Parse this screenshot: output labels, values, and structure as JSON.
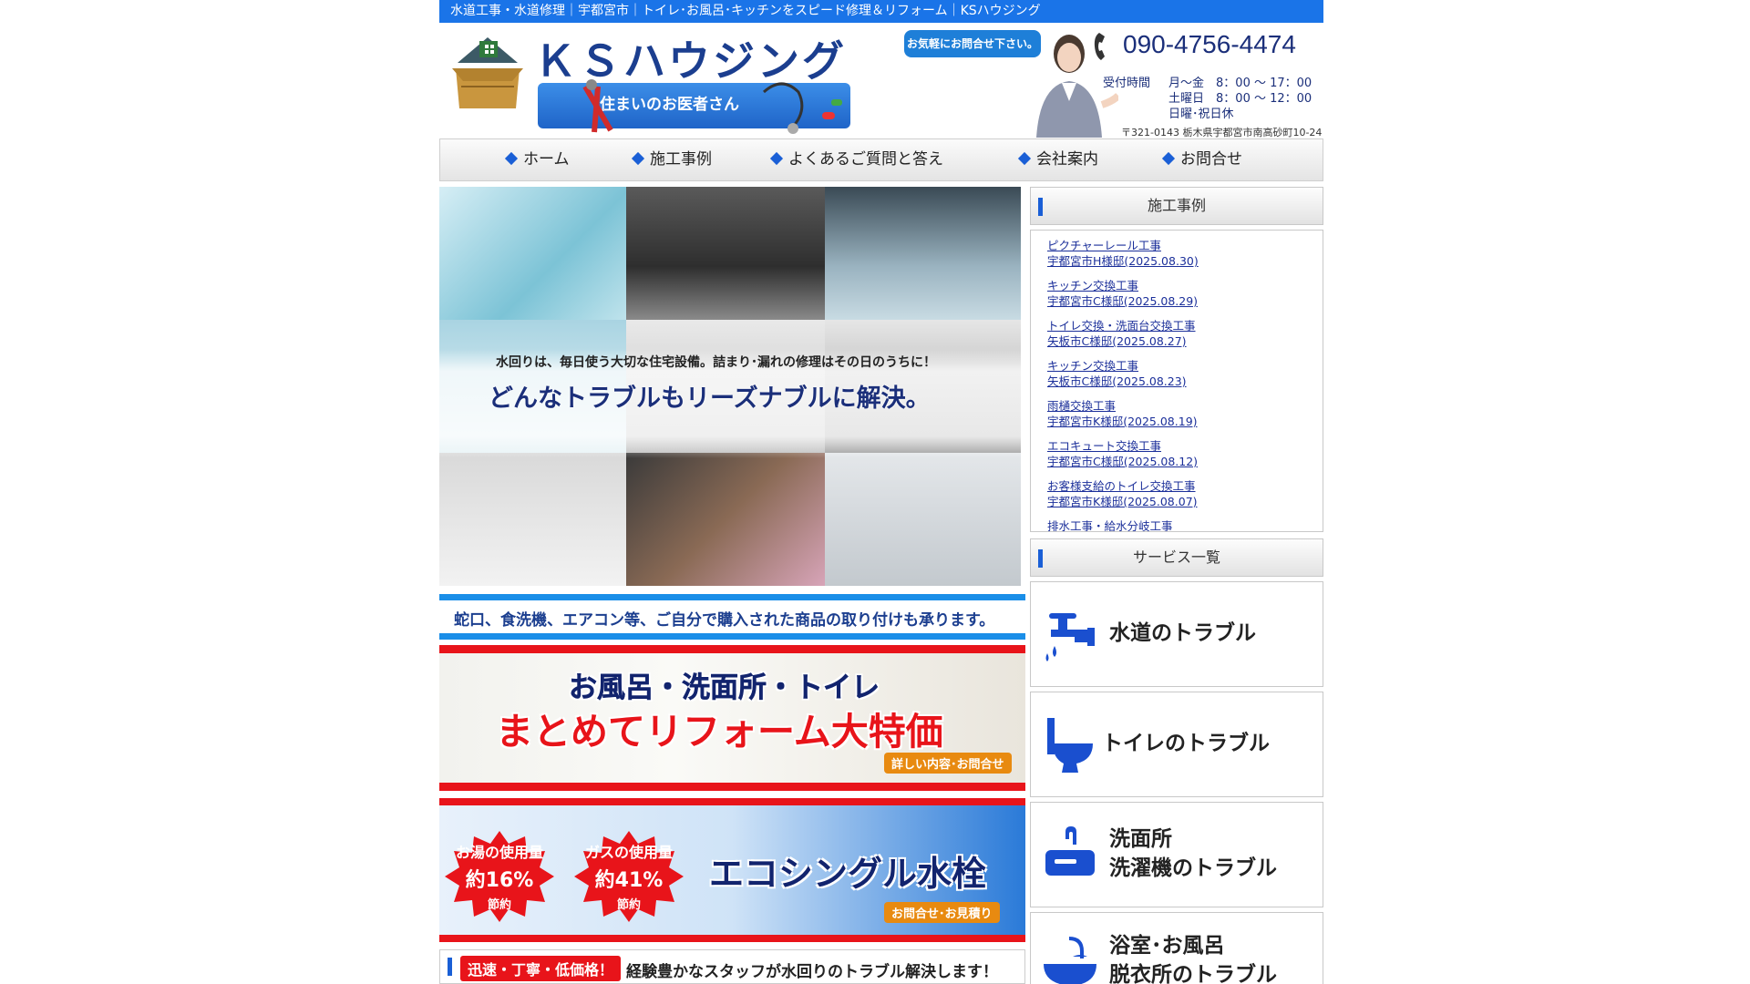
{
  "topbar": {
    "text": "水道工事・水道修理｜宇都宮市｜トイレ･お風呂･キッチンをスピード修理＆リフォーム｜KSハウジング"
  },
  "header": {
    "logo_text": "ＫＳハウジング",
    "logo_sub": "住まいのお医者さん",
    "bubble": "お気軽にお問合せ下さい。",
    "phone": "090-4756-4474",
    "hours": [
      {
        "label": "受付時間",
        "days": "月～金",
        "time": "8：00 ～ 17：00"
      },
      {
        "label": "",
        "days": "土曜日",
        "time": "8：00 ～ 12：00"
      },
      {
        "label": "",
        "days": "日曜･祝日休",
        "time": ""
      }
    ],
    "address": "〒321-0143 栃木県宇都宮市南高砂町10-24"
  },
  "nav": [
    {
      "label": "ホーム"
    },
    {
      "label": "施工事例"
    },
    {
      "label": "よくあるご質問と答え"
    },
    {
      "label": "会社案内"
    },
    {
      "label": "お問合せ"
    }
  ],
  "hero": {
    "line1": "水回りは、毎日使う大切な住宅設備。詰まり･漏れの修理はその日のうちに！",
    "line2": "どんなトラブルもリーズナブルに解決。"
  },
  "banners": {
    "install": "蛇口、食洗機、エアコン等、ご自分で購入された商品の取り付けも承ります。",
    "reform": {
      "line1": "お風呂・洗面所・トイレ",
      "line2": "まとめてリフォーム大特価",
      "tag": "詳しい内容･お問合せ"
    },
    "eco": {
      "badge1": {
        "title": "お湯の使用量",
        "value": "約16%",
        "sub": "節約"
      },
      "badge2": {
        "title": "ガスの使用量",
        "value": "約41%",
        "sub": "節約"
      },
      "title": "エコシングル水栓",
      "tag": "お問合せ･お見積り"
    }
  },
  "bottom": {
    "pill": "迅速・丁寧・低価格！",
    "text": "経験豊かなスタッフが水回りのトラブル解決します！"
  },
  "sidebar": {
    "works_title": "施工事例",
    "works": [
      {
        "title": "ピクチャーレール工事",
        "sub": "宇都宮市H様邸(2025.08.30)"
      },
      {
        "title": "キッチン交換工事",
        "sub": "宇都宮市C様邸(2025.08.29)"
      },
      {
        "title": "トイレ交換・洗面台交換工事",
        "sub": "矢板市C様邸(2025.08.27)"
      },
      {
        "title": "キッチン交換工事",
        "sub": "矢板市C様邸(2025.08.23)"
      },
      {
        "title": "雨樋交換工事",
        "sub": "宇都宮市K様邸(2025.08.19)"
      },
      {
        "title": "エコキュート交換工事",
        "sub": "宇都宮市C様邸(2025.08.12)"
      },
      {
        "title": "お客様支給のトイレ交換工事",
        "sub": "宇都宮市K様邸(2025.08.07)"
      },
      {
        "title": "排水工事・給水分岐工事",
        "sub": ""
      }
    ],
    "services_title": "サービス一覧",
    "services": [
      {
        "line1": "水道のトラブル",
        "line2": ""
      },
      {
        "line1": "トイレのトラブル",
        "line2": ""
      },
      {
        "line1": "洗面所",
        "line2": "洗濯機のトラブル"
      },
      {
        "line1": "浴室･お風呂",
        "line2": "脱衣所のトラブル"
      }
    ]
  },
  "colors": {
    "accent": "#1a74e8",
    "navy": "#1b2f7a",
    "red": "#e8141a",
    "orange": "#e88a10"
  }
}
